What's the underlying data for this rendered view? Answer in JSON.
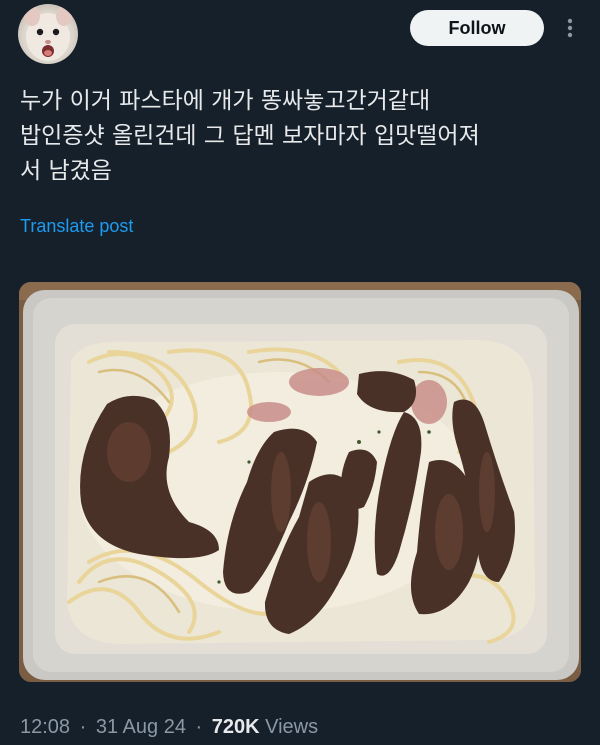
{
  "header": {
    "follow_label": "Follow",
    "more_icon": "more-vertical-icon",
    "avatar_icon": "avatar"
  },
  "post": {
    "lines": [
      "누가 이거 파스타에 개가 똥싸놓고간거같대",
      "밥인증샷 올린건데 그 답멘 보자마자 입맛떨어져",
      "서 남겼음"
    ],
    "translate_label": "Translate post"
  },
  "meta": {
    "time": "12:08",
    "separator": "·",
    "date": "31 Aug 24",
    "views_count": "720K",
    "views_label": "Views"
  },
  "colors": {
    "background": "#15202b",
    "text": "#e7e9ea",
    "link": "#1d9bf0",
    "muted": "#8b98a5",
    "button_bg": "#eff3f4"
  }
}
